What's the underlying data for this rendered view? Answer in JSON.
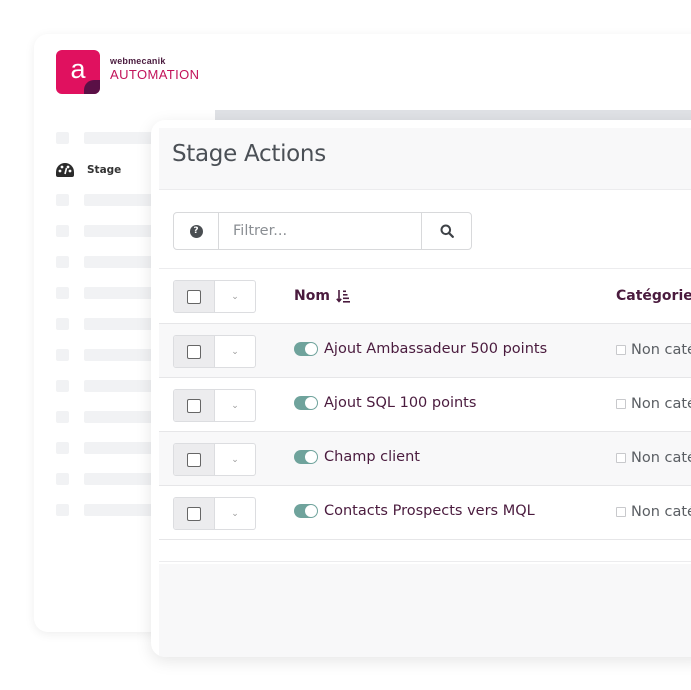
{
  "brand": {
    "company": "webmecanik",
    "product": "AUTOMATION",
    "logo_letter": "a",
    "primary_color": "#e0115f",
    "dark_color": "#4a1b3e"
  },
  "sidebar": {
    "active_item": {
      "label": "Stage",
      "icon": "dashboard-gauge-icon"
    }
  },
  "page": {
    "title": "Stage Actions"
  },
  "filter": {
    "help_icon": "question-circle-icon",
    "placeholder": "Filtrer...",
    "value": "",
    "search_icon": "search-icon"
  },
  "table": {
    "columns": [
      {
        "label": "Nom",
        "sort_icon": "sort-amount-down-icon"
      },
      {
        "label": "Catégorie"
      }
    ],
    "rows": [
      {
        "name": "Ajout Ambassadeur 500 points",
        "category": "Non catégorisé",
        "published": true
      },
      {
        "name": "Ajout SQL 100 points",
        "category": "Non catégorisé",
        "published": true
      },
      {
        "name": "Champ client",
        "category": "Non catégorisé",
        "published": true
      },
      {
        "name": "Contacts Prospects vers MQL",
        "category": "Non catégorisé",
        "published": true
      }
    ],
    "toggle_color": "#6fa39c"
  }
}
